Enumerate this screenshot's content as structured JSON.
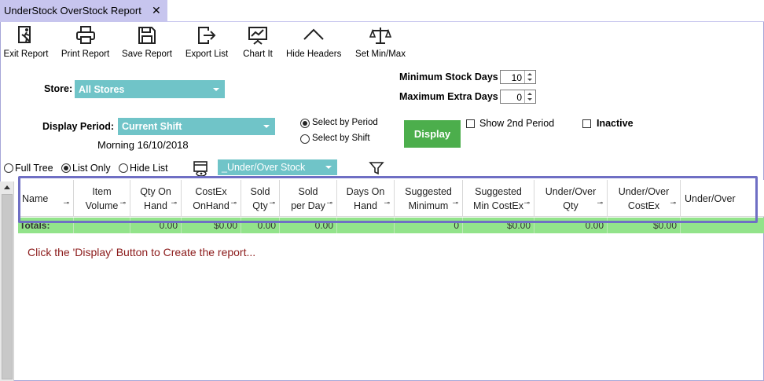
{
  "tab": {
    "title": "UnderStock OverStock Report",
    "close": "✕"
  },
  "toolbar": [
    {
      "label": "Exit Report",
      "icon": "exit-icon"
    },
    {
      "label": "Print Report",
      "icon": "printer-icon"
    },
    {
      "label": "Save Report",
      "icon": "save-icon"
    },
    {
      "label": "Export List",
      "icon": "export-icon"
    },
    {
      "label": "Chart It",
      "icon": "chart-icon"
    },
    {
      "label": "Hide Headers",
      "icon": "chevron-up-icon"
    },
    {
      "label": "Set Min/Max",
      "icon": "scales-icon"
    }
  ],
  "filters": {
    "store_label": "Store:",
    "store_value": "All Stores",
    "period_label": "Display Period:",
    "period_value": "Current Shift",
    "shift_info": "Morning 16/10/2018",
    "min_stock_label": "Minimum Stock Days",
    "min_stock_value": "10",
    "max_extra_label": "Maximum Extra Days",
    "max_extra_value": "0",
    "select_by_period": "Select by Period",
    "select_by_shift": "Select by Shift",
    "display_button": "Display",
    "show_2nd_period": "Show 2nd Period",
    "inactive": "Inactive"
  },
  "view": {
    "full_tree": "Full Tree",
    "list_only": "List Only",
    "hide_list": "Hide List",
    "layout_value": "_Under/Over Stock"
  },
  "columns": [
    "Name",
    "Item\nVolume",
    "Qty On\nHand",
    "CostEx\nOnHand",
    "Sold\nQty",
    "Sold\nper Day",
    "Days On\nHand",
    "Suggested\nMinimum",
    "Suggested\nMin CostEx",
    "Under/Over\nQty",
    "Under/Over\nCostEx",
    "Under/Over"
  ],
  "totals": [
    "Totals:",
    "",
    "0.00",
    "$0.00",
    "0.00",
    "0.00",
    "",
    "0",
    "$0.00",
    "0.00",
    "$0.00",
    ""
  ],
  "message": "Click the 'Display' Button to Create the report..."
}
